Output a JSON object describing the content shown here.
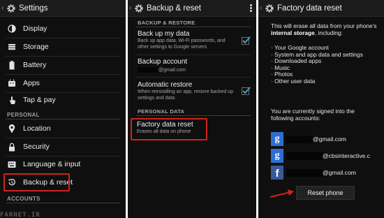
{
  "panel1": {
    "title": "Settings",
    "items": [
      {
        "label": "Display",
        "icon": "display-icon"
      },
      {
        "label": "Storage",
        "icon": "storage-icon"
      },
      {
        "label": "Battery",
        "icon": "battery-icon"
      },
      {
        "label": "Apps",
        "icon": "apps-icon"
      },
      {
        "label": "Tap & pay",
        "icon": "tap-pay-icon"
      }
    ],
    "personal_header": "PERSONAL",
    "personal_items": [
      {
        "label": "Location",
        "icon": "location-icon"
      },
      {
        "label": "Security",
        "icon": "lock-icon"
      },
      {
        "label": "Language & input",
        "icon": "language-icon"
      },
      {
        "label": "Backup & reset",
        "icon": "backup-reset-icon"
      }
    ],
    "accounts_header": "ACCOUNTS",
    "watermark": "FARNET.IR"
  },
  "panel2": {
    "title": "Backup & reset",
    "section1": "BACKUP & RESTORE",
    "backup_data": {
      "title": "Back up my data",
      "summary": "Back up app data, Wi-Fi passwords, and other settings to Google servers"
    },
    "backup_account": {
      "title": "Backup account",
      "email_suffix": "@gmail.com"
    },
    "auto_restore": {
      "title": "Automatic restore",
      "summary": "When reinstalling an app, restore backed up settings and data"
    },
    "section2": "PERSONAL DATA",
    "factory_reset": {
      "title": "Factory data reset",
      "summary": "Erases all data on phone"
    }
  },
  "panel3": {
    "title": "Factory data reset",
    "intro_part1": "This will erase all data from your phone's ",
    "intro_bold": "internal storage",
    "intro_part2": ", including:",
    "list": [
      "Your Google account",
      "System and app data and settings",
      "Downloaded apps",
      "Music",
      "Photos",
      "Other user data"
    ],
    "signed_in": "You are currently signed into the following accounts:",
    "accounts": [
      {
        "icon": "google-icon",
        "suffix": "@gmail.com"
      },
      {
        "icon": "google-icon",
        "suffix": "@cbsinteractive.c"
      },
      {
        "icon": "facebook-icon",
        "suffix": "@gmail.com"
      }
    ],
    "reset_button": "Reset phone"
  },
  "colors": {
    "highlight": "#d0241c",
    "checkbox": "#3aa0d8",
    "background": "#0f0f0f"
  }
}
